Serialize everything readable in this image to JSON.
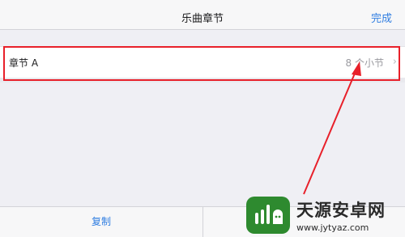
{
  "window": {
    "controls": [
      "_",
      "□",
      "×"
    ]
  },
  "nav": {
    "title": "乐曲章节",
    "done_label": "完成"
  },
  "sections": [
    {
      "label": "章节 A",
      "detail": "8 个小节",
      "chevron": "›"
    }
  ],
  "toolbar": {
    "copy_label": "复制"
  },
  "watermark": {
    "name": "天源安卓网",
    "url": "www.jytyaz.com"
  },
  "colors": {
    "accent": "#2f7de1",
    "annotation": "#e8202a",
    "watermark_logo": "#2e8a2f"
  }
}
